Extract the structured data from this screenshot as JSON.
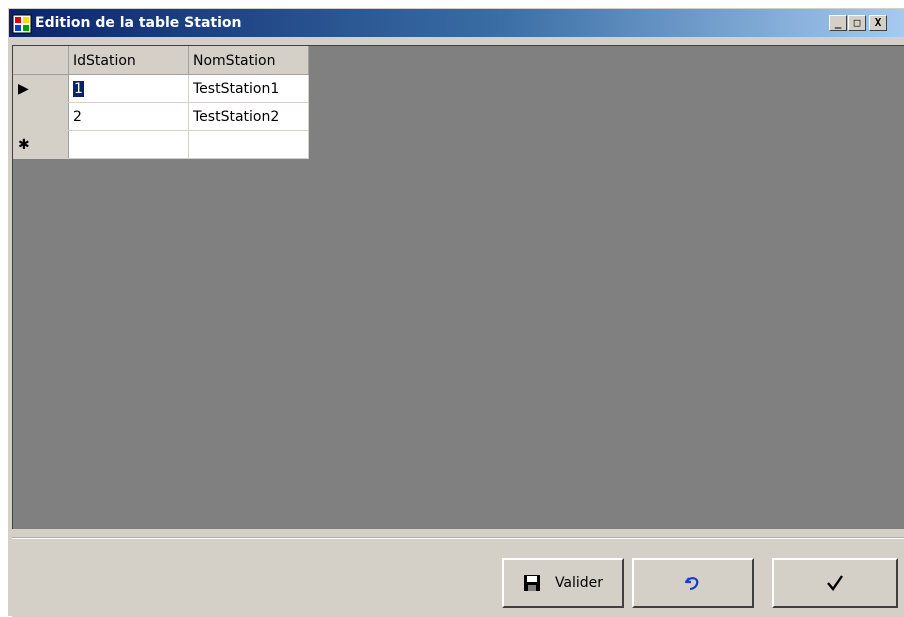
{
  "window": {
    "title": "Edition de la table Station",
    "buttons": {
      "minimize": "_",
      "maximize": "□",
      "close": "X"
    }
  },
  "grid": {
    "columns": [
      "IdStation",
      "NomStation"
    ],
    "rows": [
      {
        "indicator": "▶",
        "id": "1",
        "nom": "TestStation1",
        "current": true
      },
      {
        "indicator": "",
        "id": "2",
        "nom": "TestStation2",
        "current": false
      },
      {
        "indicator": "✱",
        "id": "",
        "nom": "",
        "new_row": true
      }
    ]
  },
  "toolbar": {
    "valider_label": "Valider",
    "valider_icon": "floppy-disk-icon",
    "annuler_icon": "undo-arrow-icon",
    "ok_icon": "checkmark-icon"
  },
  "colors": {
    "title_gradient_start": "#0a246a",
    "title_gradient_end": "#a6caf0",
    "grid_background": "#808080",
    "panel": "#d4d0c8"
  }
}
